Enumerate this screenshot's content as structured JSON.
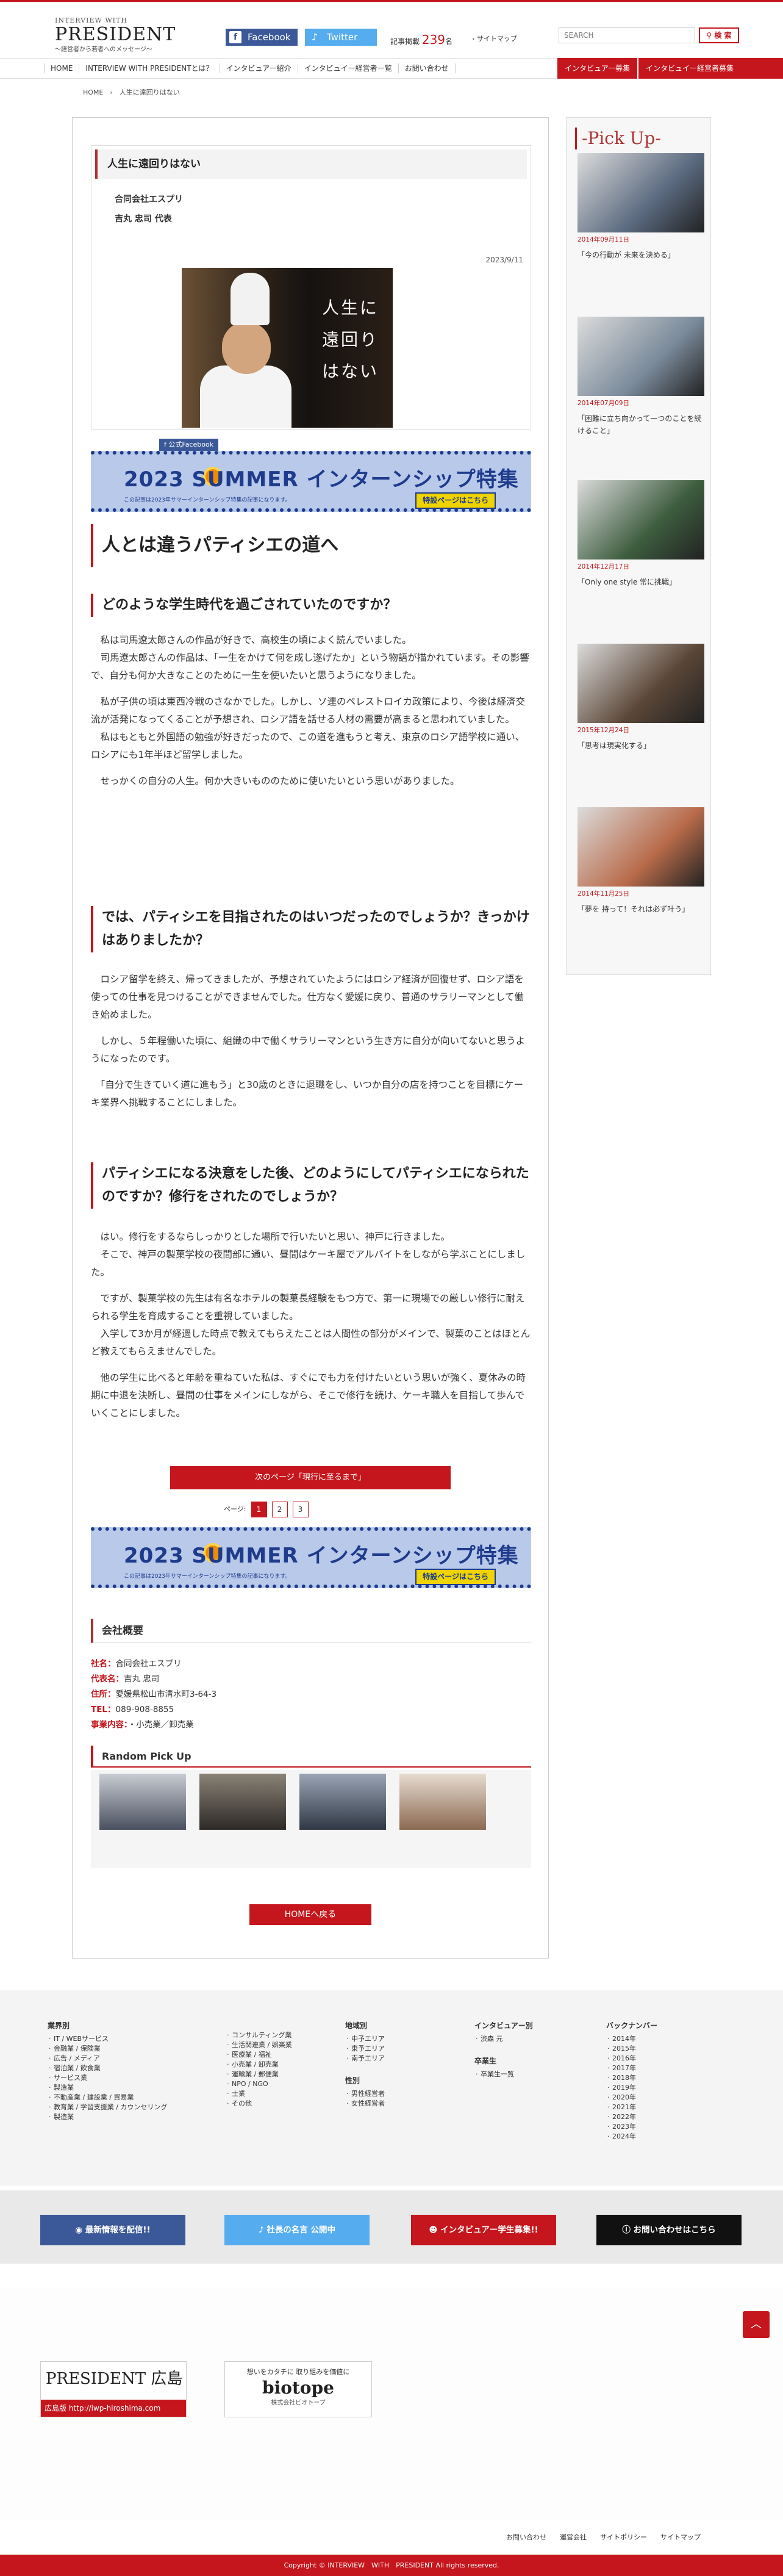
{
  "header": {
    "logo_line1": "INTERVIEW WITH",
    "logo_line2": "PRESIDENT",
    "logo_line3": "〜経営者から若者へのメッセージ〜",
    "facebook": "Facebook",
    "twitter": "Twitter",
    "kiji_prefix": "記事掲載",
    "kiji_count": "239",
    "kiji_suffix": "名",
    "sitemap": "サイトマップ",
    "search_placeholder": "SEARCH",
    "search_button": "検 索"
  },
  "nav": {
    "items": [
      "HOME",
      "INTERVIEW WITH PRESIDENTとは？",
      "インタビュアー紹介",
      "インタビュイー経営者一覧",
      "お問い合わせ"
    ],
    "red_items": [
      "インタビュアー募集",
      "インタビュイー経営者募集"
    ]
  },
  "breadcrumb": "HOME　›　人生に遠回りはない",
  "article": {
    "intro_title": "人生に遠回りはない",
    "company": "合同会社エスプリ",
    "person": "吉丸 忠司 代表",
    "date": "2023/9/11",
    "hero_text": "人生に遠回りはない",
    "fb_badge": "公式Facebook",
    "banner_big": "2023 SUMMER インターンシップ特集",
    "banner_small": "この記事は2023年サマーインターンシップ特集の記事になります。",
    "banner_btn": "特設ページはこちら",
    "main_heading": "人とは違うパティシエの道へ",
    "q1": "どのような学生時代を過ごされていたのですか？",
    "a1": [
      "　私は司馬遼太郎さんの作品が好きで、高校生の頃によく読んでいました。",
      "　司馬遼太郎さんの作品は、「一生をかけて何を成し遂げたか」という物語が描かれています。その影響で、自分も何か大きなことのために一生を使いたいと思うようになりました。",
      "　私が子供の頃は東西冷戦のさなかでした。しかし、ソ連のペレストロイカ政策により、今後は経済交流が活発になってくることが予想され、ロシア語を話せる人材の需要が高まると思われていました。",
      "　私はもともと外国語の勉強が好きだったので、この道を進もうと考え、東京のロシア語学校に通い、ロシアにも1年半ほど留学しました。",
      "　せっかくの自分の人生。何か大きいもののために使いたいという思いがありました。"
    ],
    "q2": "では、パティシエを目指されたのはいつだったのでしょうか？きっかけはありましたか？",
    "a2": [
      "　ロシア留学を終え、帰ってきましたが、予想されていたようにはロシア経済が回復せず、ロシア語を使っての仕事を見つけることができませんでした。仕方なく愛媛に戻り、普通のサラリーマンとして働き始めました。",
      "　しかし、５年程働いた頃に、組織の中で働くサラリーマンという生き方に自分が向いてないと思うようになったのです。",
      "　「自分で生きていく道に進もう」と30歳のときに退職をし、いつか自分の店を持つことを目標にケーキ業界へ挑戦することにしました。"
    ],
    "q3": "パティシエになる決意をした後、どのようにしてパティシエになられたのですか？修行をされたのでしょうか？",
    "a3": [
      "　はい。修行をするならしっかりとした場所で行いたいと思い、神戸に行きました。",
      "　そこで、神戸の製菓学校の夜間部に通い、昼間はケーキ屋でアルバイトをしながら学ぶことにしました。",
      "　ですが、製菓学校の先生は有名なホテルの製菓長経験をもつ方で、第一に現場での厳しい修行に耐えられる学生を育成することを重視していました。",
      "　入学して3か月が経過した時点で教えてもらえたことは人間性の部分がメインで、製菓のことはほとんど教えてもらえませんでした。",
      "　他の学生に比べると年齢を重ねていた私は、すぐにでも力を付けたいという思いが強く、夏休みの時期に中退を決断し、昼間の仕事をメインにしながら、そこで修行を続け、ケーキ職人を目指して歩んでいくことにしました。"
    ],
    "next_page": "次のページ「現行に至るまで」",
    "pager_label": "ページ:",
    "pages": [
      "1",
      "2",
      "3"
    ]
  },
  "company_info": {
    "heading": "会社概要",
    "rows": [
      {
        "k": "社名：",
        "v": "合同会社エスプリ"
      },
      {
        "k": "代表名：",
        "v": "吉丸 忠司"
      },
      {
        "k": "住所：",
        "v": "愛媛県松山市清水町3-64-3"
      },
      {
        "k": "TEL：",
        "v": "089-908-8855"
      },
      {
        "k": "事業内容：",
        "v": "・小売業／卸売業"
      }
    ]
  },
  "random_pickup": {
    "heading": "Random Pick Up"
  },
  "home_button": "HOMEへ戻る",
  "sidebar": {
    "heading": "-Pick Up-",
    "items": [
      {
        "date": "2014年09月11日",
        "title": "「今の行動が 未来を決める」",
        "img_color": "#5b6a80"
      },
      {
        "date": "2014年07月09日",
        "title": "「困難に立ち向かって一つのことを続けること」",
        "img_color": "#7a8a9a"
      },
      {
        "date": "2014年12月17日",
        "title": "「Only one style 常に挑戦」",
        "img_color": "#3d5d3f"
      },
      {
        "date": "2015年12月24日",
        "title": "「思考は現実化する」",
        "img_color": "#5a4637"
      },
      {
        "date": "2014年11月25日",
        "title": "「夢を 持って！それは必ず叶う」",
        "img_color": "#b86b4a"
      }
    ]
  },
  "footer": {
    "cols": [
      {
        "heading": "業界別",
        "items": [
          "IT / WEBサービス",
          "金融業 / 保険業",
          "広告 / メディア",
          "宿泊業 / 飲食業",
          "サービス業",
          "製造業",
          "不動産業 / 建設業 / 貿易業",
          "教育業 / 学習支援業 / カウンセリング",
          "製造業"
        ]
      },
      {
        "heading": "",
        "items": [
          "コンサルティング業",
          "生活関連業 / 娯楽業",
          "医療業 / 福祉",
          "小売業 / 卸売業",
          "運輸業 / 郵便業",
          "NPO / NGO",
          "士業",
          "その他"
        ]
      },
      {
        "heading": "地域別",
        "items": [
          "中予エリア",
          "東予エリア",
          "南予エリア"
        ],
        "heading2": "性別",
        "items2": [
          "男性経営者",
          "女性経営者"
        ]
      },
      {
        "heading": "インタビュアー別",
        "sub": "卒業生",
        "items": [
          "渋森 元"
        ],
        "heading2": "卒業生",
        "items2": [
          "卒業生一覧"
        ]
      },
      {
        "heading": "バックナンバー",
        "items": [
          "2014年",
          "2015年",
          "2016年",
          "2017年",
          "2018年",
          "2019年",
          "2020年",
          "2021年",
          "2022年",
          "2023年",
          "2024年"
        ]
      }
    ],
    "share": [
      {
        "label": "最新情報を配信!!",
        "color": "#3b5998"
      },
      {
        "label": "社長の名言 公開中",
        "color": "#55acee"
      },
      {
        "label": "インタビュアー学生募集!!",
        "color": "#c4161c"
      },
      {
        "label": "お問い合わせはこちら",
        "color": "#111111"
      }
    ],
    "ad1_title": "PRESIDENT 広島",
    "ad1_url": "広島版 http://iwp-hiroshima.com",
    "ad2_line1": "想いをカタチに 取り組みを価値に",
    "ad2_name": "biotope",
    "ad2_line3": "株式会社ビオトープ",
    "links": [
      "お問い合わせ",
      "運営会社",
      "サイトポリシー",
      "サイトマップ"
    ],
    "copyright": "Copyright ©  INTERVIEW　WITH　PRESIDENT All rights reserved."
  }
}
